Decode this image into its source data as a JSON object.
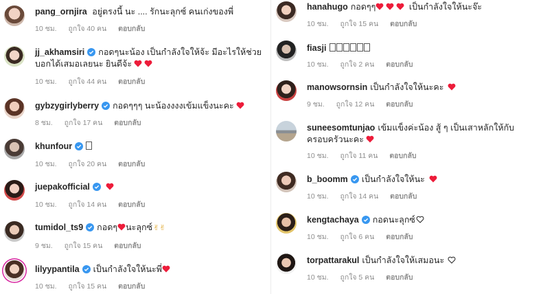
{
  "colors": {
    "heart": "#ed1c3a",
    "verified": "#3897f0",
    "meta": "#8e8e8e"
  },
  "icons": {
    "verified": "verified-badge-icon",
    "heart": "red-heart-icon",
    "heart_outline": "heart-outline-icon",
    "ok_hand": "ok-hand-icon"
  },
  "comments_left": [
    {
      "username": "pang_ornjira",
      "verified": false,
      "text": "อยู่ตรงนี้ นะ .... รักนะลุกซ์ คนเก่งของพี่",
      "time": "10 ชม.",
      "likes": "ถูกใจ 40 คน",
      "reply": "ตอบกลับ"
    },
    {
      "username": "jj_akhamsiri",
      "verified": true,
      "text": "กอดๆนะน้อง เป็นกำลังใจให้จ้ะ มีอะไรให้ช่วยบอกได้เสมอเลยนะ ยินดีจ้ะ",
      "hearts": 2,
      "time": "10 ชม.",
      "likes": "ถูกใจ 44 คน",
      "reply": "ตอบกลับ"
    },
    {
      "username": "gybzygirlyberry",
      "verified": true,
      "text": "กอดๆๆๆ นะน้องงงงเข้มแข็งนะคะ",
      "hearts": 1,
      "time": "8 ชม.",
      "likes": "ถูกใจ 17 คน",
      "reply": "ตอบกลับ"
    },
    {
      "username": "khunfour",
      "verified": true,
      "text": "",
      "boxes": 1,
      "time": "10 ชม.",
      "likes": "ถูกใจ 20 คน",
      "reply": "ตอบกลับ"
    },
    {
      "username": "juepakofficial",
      "verified": true,
      "text": "",
      "hearts": 1,
      "time": "10 ชม.",
      "likes": "ถูกใจ 14 คน",
      "reply": "ตอบกลับ"
    },
    {
      "username": "tumidol_ts9",
      "verified": true,
      "text": "กอดๆ",
      "text2": "นะลุกซ์",
      "time": "9 ชม.",
      "likes": "ถูกใจ 15 คน",
      "reply": "ตอบกลับ"
    },
    {
      "username": "lilyypantila",
      "verified": true,
      "text": "เป็นกำลังใจให้นะพี่",
      "hearts": 1,
      "time": "10 ชม.",
      "likes": "ถูกใจ 15 คน",
      "reply": "ตอบกลับ"
    }
  ],
  "comments_right": [
    {
      "username": "hanahugo",
      "verified": false,
      "text": "กอดๆๆ",
      "text2": "เป็นกำลังใจให้นะจ๊ะ",
      "hearts": 3,
      "time": "10 ชม.",
      "likes": "ถูกใจ 15 คน",
      "reply": "ตอบกลับ"
    },
    {
      "username": "fiasji",
      "verified": false,
      "text": "",
      "boxes": 6,
      "time": "10 ชม.",
      "likes": "ถูกใจ 2 คน",
      "reply": "ตอบกลับ"
    },
    {
      "username": "manowsornsin",
      "verified": false,
      "text": "เป็นกำลังใจให้นะคะ",
      "hearts": 1,
      "time": "9 ชม.",
      "likes": "ถูกใจ 12 คน",
      "reply": "ตอบกลับ"
    },
    {
      "username": "suneesomtunjao",
      "verified": false,
      "text": "เข้มแข็งค่ะน้อง สู้ ๆ เป็นเสาหลักให้กับครอบครัวนะคะ",
      "hearts": 1,
      "time": "10 ชม.",
      "likes": "ถูกใจ 11 คน",
      "reply": "ตอบกลับ"
    },
    {
      "username": "b_boomm",
      "verified": true,
      "text": "เป็นกำลังใจให้นะ",
      "hearts": 1,
      "time": "10 ชม.",
      "likes": "ถูกใจ 14 คน",
      "reply": "ตอบกลับ"
    },
    {
      "username": "kengtachaya",
      "verified": true,
      "text": "กอดนะลุกซ์",
      "outline_heart": true,
      "time": "10 ชม.",
      "likes": "ถูกใจ 6 คน",
      "reply": "ตอบกลับ"
    },
    {
      "username": "torpattarakul",
      "verified": false,
      "text": "เป็นกำลังใจให้เสมอนะ",
      "outline_heart": true,
      "time": "10 ชม.",
      "likes": "ถูกใจ 5 คน",
      "reply": "ตอบกลับ"
    }
  ]
}
